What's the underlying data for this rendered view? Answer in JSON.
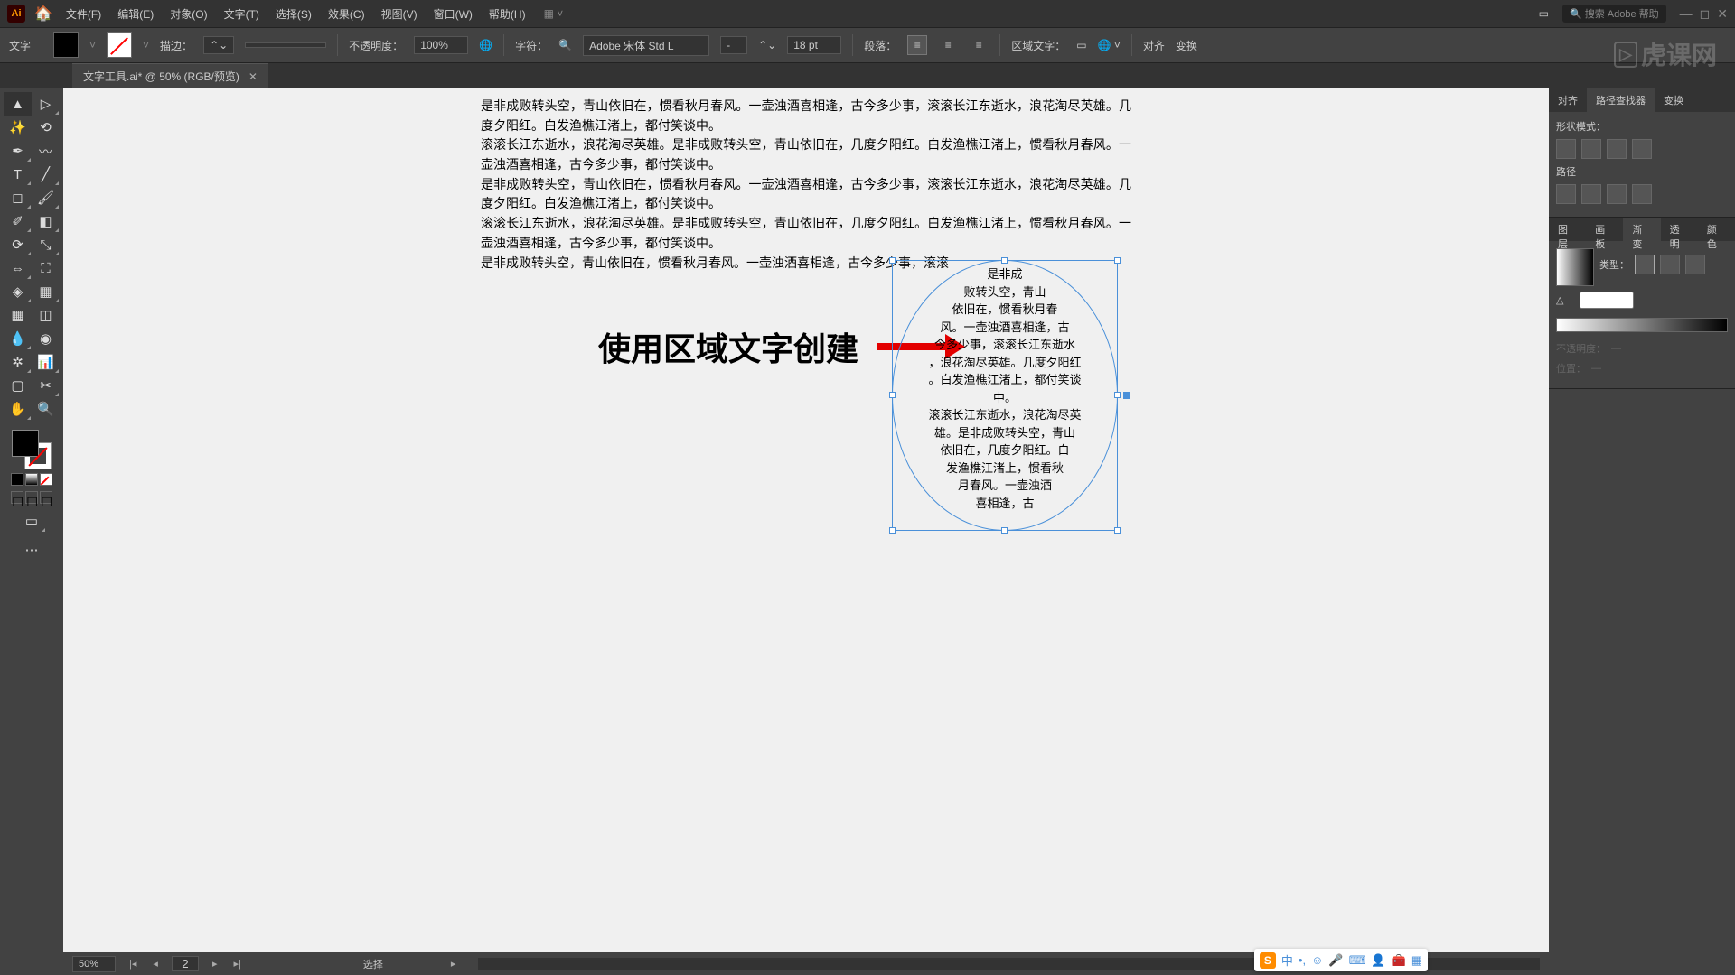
{
  "menu": {
    "file": "文件(F)",
    "edit": "编辑(E)",
    "object": "对象(O)",
    "type": "文字(T)",
    "select": "选择(S)",
    "effect": "效果(C)",
    "view": "视图(V)",
    "window": "窗口(W)",
    "help": "帮助(H)"
  },
  "search_placeholder": "搜索 Adobe 帮助",
  "watermark": "虎课网",
  "optbar": {
    "context": "文字",
    "stroke": "描边：",
    "opacity_label": "不透明度：",
    "opacity": "100%",
    "char": "字符：",
    "font": "Adobe 宋体 Std L",
    "style": "-",
    "size": "18 pt",
    "para": "段落：",
    "areatype": "区域文字：",
    "align": "对齐",
    "transform": "变换"
  },
  "tab": {
    "name": "文字工具.ai* @ 50% (RGB/预览)"
  },
  "annotation": "使用区域文字创建",
  "body_text": "是非成败转头空，青山依旧在，惯看秋月春风。一壶浊酒喜相逢，古今多少事，滚滚长江东逝水，浪花淘尽英雄。几度夕阳红。白发渔樵江渚上，都付笑谈中。\n滚滚长江东逝水，浪花淘尽英雄。是非成败转头空，青山依旧在，几度夕阳红。白发渔樵江渚上，惯看秋月春风。一壶浊酒喜相逢，古今多少事，都付笑谈中。\n是非成败转头空，青山依旧在，惯看秋月春风。一壶浊酒喜相逢，古今多少事，滚滚长江东逝水，浪花淘尽英雄。几度夕阳红。白发渔樵江渚上，都付笑谈中。\n滚滚长江东逝水，浪花淘尽英雄。是非成败转头空，青山依旧在，几度夕阳红。白发渔樵江渚上，惯看秋月春风。一壶浊酒喜相逢，古今多少事，都付笑谈中。\n是非成败转头空，青山依旧在，惯看秋月春风。一壶浊酒喜相逢，古今多少事，滚滚",
  "area_lines": [
    "是非成",
    "败转头空，青山",
    "依旧在，惯看秋月春",
    "风。一壶浊酒喜相逢，古",
    "今多少事，滚滚长江东逝水",
    "，浪花淘尽英雄。几度夕阳红",
    "。白发渔樵江渚上，都付笑谈",
    "中。",
    "滚滚长江东逝水，浪花淘尽英",
    "雄。是非成败转头空，青山",
    "依旧在，几度夕阳红。白",
    "发渔樵江渚上，惯看秋",
    "月春风。一壶浊酒",
    "喜相逢，古"
  ],
  "status": {
    "zoom": "50%",
    "artboard": "2",
    "tool": "选择"
  },
  "panels": {
    "align": "对齐",
    "pathfinder": "路径查找器",
    "transform": "变换",
    "shapemode": "形状模式：",
    "pathf": "路径",
    "layers": "图层",
    "artboards": "画板",
    "gradient": "渐变",
    "transparency": "透明",
    "color": "颜色",
    "type": "类型：",
    "opacity": "不透明度：",
    "position": "位置："
  },
  "ime": {
    "lang": "中"
  }
}
